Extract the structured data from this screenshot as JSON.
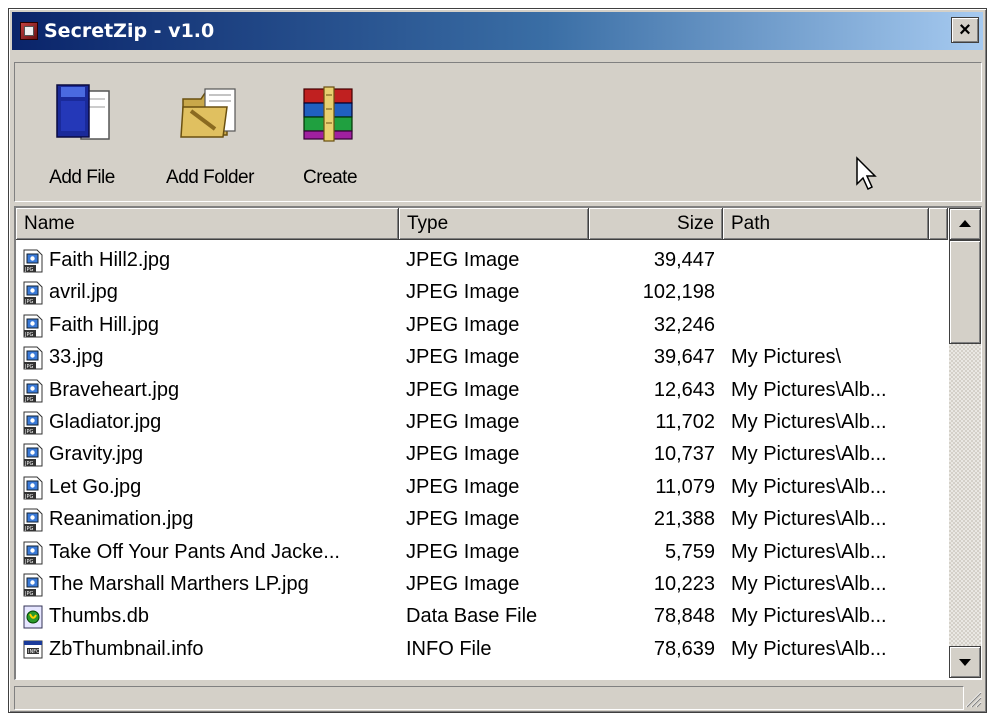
{
  "window": {
    "title": "SecretZip - v1.0",
    "close_label": "×"
  },
  "toolbar": {
    "add_file": "Add File",
    "add_folder": "Add Folder",
    "create": "Create"
  },
  "columns": {
    "name": "Name",
    "type": "Type",
    "size": "Size",
    "path": "Path"
  },
  "files": [
    {
      "name": "Faith Hill2.jpg",
      "type": "JPEG Image",
      "size": "39,447",
      "path": "",
      "icon": "jpeg-file-icon"
    },
    {
      "name": "avril.jpg",
      "type": "JPEG Image",
      "size": "102,198",
      "path": "",
      "icon": "jpeg-file-icon"
    },
    {
      "name": "Faith Hill.jpg",
      "type": "JPEG Image",
      "size": "32,246",
      "path": "",
      "icon": "jpeg-file-icon"
    },
    {
      "name": "33.jpg",
      "type": "JPEG Image",
      "size": "39,647",
      "path": "My Pictures\\",
      "icon": "jpeg-file-icon"
    },
    {
      "name": "Braveheart.jpg",
      "type": "JPEG Image",
      "size": "12,643",
      "path": "My Pictures\\Alb...",
      "icon": "jpeg-file-icon"
    },
    {
      "name": "Gladiator.jpg",
      "type": "JPEG Image",
      "size": "11,702",
      "path": "My Pictures\\Alb...",
      "icon": "jpeg-file-icon"
    },
    {
      "name": "Gravity.jpg",
      "type": "JPEG Image",
      "size": "10,737",
      "path": "My Pictures\\Alb...",
      "icon": "jpeg-file-icon"
    },
    {
      "name": "Let Go.jpg",
      "type": "JPEG Image",
      "size": "11,079",
      "path": "My Pictures\\Alb...",
      "icon": "jpeg-file-icon"
    },
    {
      "name": "Reanimation.jpg",
      "type": "JPEG Image",
      "size": "21,388",
      "path": "My Pictures\\Alb...",
      "icon": "jpeg-file-icon"
    },
    {
      "name": "Take Off Your Pants And Jacke...",
      "type": "JPEG Image",
      "size": "5,759",
      "path": "My Pictures\\Alb...",
      "icon": "jpeg-file-icon"
    },
    {
      "name": "The Marshall Marthers LP.jpg",
      "type": "JPEG Image",
      "size": "10,223",
      "path": "My Pictures\\Alb...",
      "icon": "jpeg-file-icon"
    },
    {
      "name": "Thumbs.db",
      "type": "Data Base File",
      "size": "78,848",
      "path": "My Pictures\\Alb...",
      "icon": "database-file-icon"
    },
    {
      "name": "ZbThumbnail.info",
      "type": "INFO File",
      "size": "78,639",
      "path": "My Pictures\\Alb...",
      "icon": "info-file-icon"
    }
  ],
  "status": {
    "text": ""
  },
  "colors": {
    "title_start": "#0a246a",
    "title_end": "#a6caf0",
    "chrome": "#d4d0c8"
  }
}
